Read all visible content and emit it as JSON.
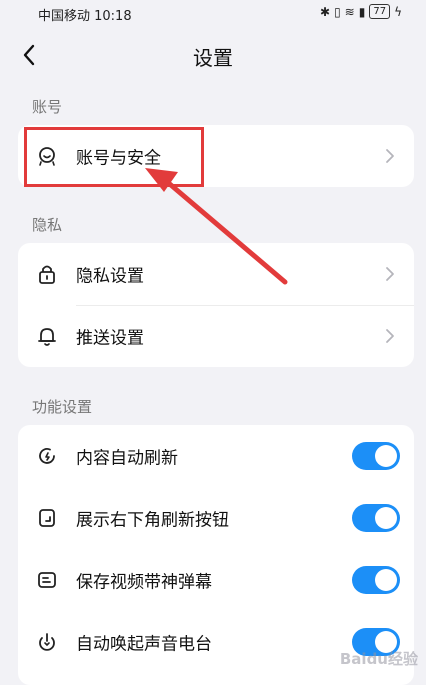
{
  "status_bar": {
    "carrier_time": "中国移动 10:18",
    "battery": "77"
  },
  "header": {
    "title": "设置"
  },
  "sections": [
    {
      "label": "账号",
      "items": [
        {
          "label": "账号与安全",
          "icon": "account-icon",
          "control": "chevron"
        }
      ]
    },
    {
      "label": "隐私",
      "items": [
        {
          "label": "隐私设置",
          "icon": "lock-icon",
          "control": "chevron"
        },
        {
          "label": "推送设置",
          "icon": "bell-icon",
          "control": "chevron"
        }
      ]
    },
    {
      "label": "功能设置",
      "items": [
        {
          "label": "内容自动刷新",
          "icon": "refresh-icon",
          "control": "toggle",
          "on": true
        },
        {
          "label": "展示右下角刷新按钮",
          "icon": "corner-button-icon",
          "control": "toggle",
          "on": true
        },
        {
          "label": "保存视频带神弹幕",
          "icon": "danmaku-icon",
          "control": "toggle",
          "on": true
        },
        {
          "label": "自动唤起声音电台",
          "icon": "radio-icon",
          "control": "toggle",
          "on": true
        }
      ]
    }
  ],
  "colors": {
    "toggle_on": "#1c8ff7",
    "highlight": "#e23b3b",
    "background": "#f2f2f6"
  },
  "watermark": "Baidu经验"
}
